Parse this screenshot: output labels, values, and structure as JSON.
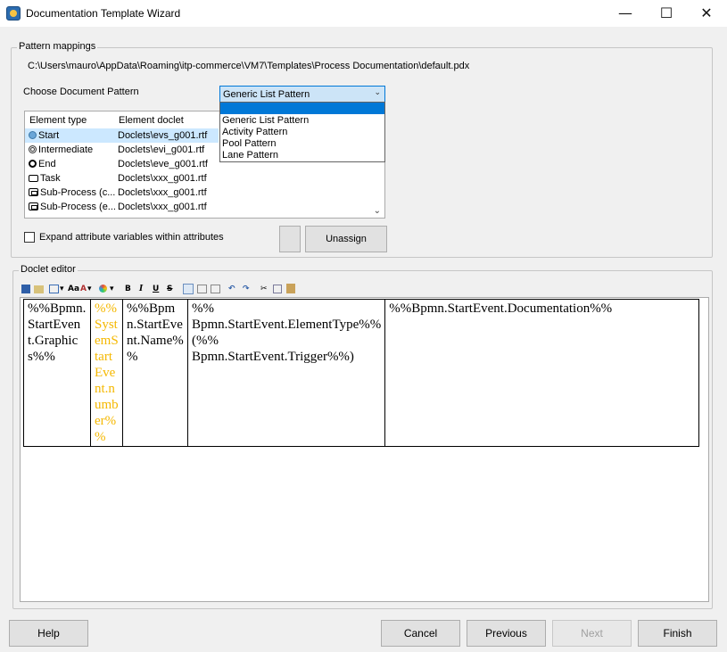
{
  "window": {
    "title": "Documentation Template Wizard",
    "minimize": "—",
    "maximize": "☐",
    "close": "✕"
  },
  "pattern_mappings": {
    "group_label": "Pattern mappings",
    "path": "C:\\Users\\mauro\\AppData\\Roaming\\itp-commerce\\VM7\\Templates\\Process  Documentation\\default.pdx",
    "choose_label": "Choose Document Pattern",
    "selected_pattern": "Generic List Pattern",
    "pattern_options": [
      "Generic List Pattern",
      "Activity Pattern",
      "Pool Pattern",
      "Lane Pattern"
    ],
    "columns": [
      "Element type",
      "Element doclet"
    ],
    "rows": [
      {
        "type": "Start",
        "icon": "start-event-icon",
        "doclet": "Doclets\\evs_g001.rtf"
      },
      {
        "type": "Intermediate",
        "icon": "intermediate-event-icon",
        "doclet": "Doclets\\evi_g001.rtf"
      },
      {
        "type": "End",
        "icon": "end-event-icon",
        "doclet": "Doclets\\eve_g001.rtf"
      },
      {
        "type": "Task",
        "icon": "task-icon",
        "doclet": "Doclets\\xxx_g001.rtf"
      },
      {
        "type": "Sub-Process (c...",
        "icon": "subprocess-icon",
        "doclet": "Doclets\\xxx_g001.rtf"
      },
      {
        "type": "Sub-Process (e...",
        "icon": "subprocess-icon",
        "doclet": "Doclets\\xxx_g001.rtf"
      }
    ],
    "expand_label": "Expand attribute variables within attributes",
    "unassign_label": "Unassign"
  },
  "doclet_editor": {
    "group_label": "Doclet editor",
    "cells": [
      "%%Bpmn.StartEvent.Graphics%%",
      "%%SystemStartEvent.number%%",
      "%%Bpmn.StartEvent.Name%%",
      "%% Bpmn.StartEvent.ElementType%% (%% Bpmn.StartEvent.Trigger%%)",
      "%%Bpmn.StartEvent.Documentation%%"
    ],
    "toolbar": {
      "font_size": "Aa",
      "font_style": "A",
      "bold": "B",
      "italic": "I",
      "underline": "U",
      "strike": "S"
    }
  },
  "footer": {
    "help": "Help",
    "cancel": "Cancel",
    "previous": "Previous",
    "next": "Next",
    "finish": "Finish"
  }
}
